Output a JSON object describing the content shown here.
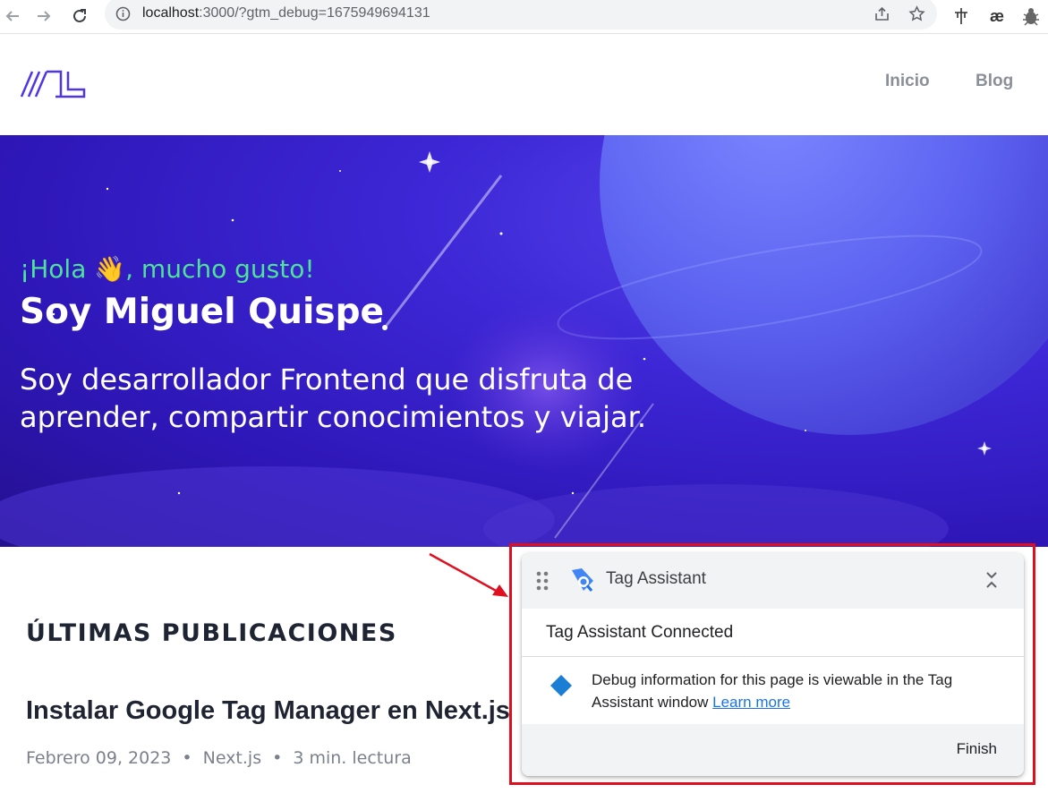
{
  "browser": {
    "url_host": "localhost",
    "url_rest": ":3000/?gtm_debug=1675949694131",
    "icons": [
      "back-icon",
      "forward-icon",
      "reload-icon",
      "info-icon",
      "share-icon",
      "star-icon",
      "move-icon",
      "ae-extension-icon",
      "bug-extension-icon"
    ],
    "ext_ae_label": "æ"
  },
  "header": {
    "nav": {
      "inicio": "Inicio",
      "blog": "Blog"
    },
    "logo_color": "#4f35e6"
  },
  "hero": {
    "greeting_pre": "¡Hola ",
    "greeting_emoji": "👋",
    "greeting_post": ", mucho gusto!",
    "name": "Soy Miguel Quispe",
    "description": "Soy desarrollador Frontend que disfruta de aprender, compartir conocimientos y viajar.",
    "accent_color": "#4ee29a"
  },
  "main": {
    "section_title": "ÚLTIMAS PUBLICACIONES",
    "post": {
      "title": "Instalar Google Tag Manager en Next.js",
      "date": "Febrero 09, 2023",
      "category": "Next.js",
      "reading_time": "3 min. lectura",
      "separator": "•"
    }
  },
  "tag_assistant": {
    "title": "Tag Assistant",
    "status": "Tag Assistant Connected",
    "message": "Debug information for this page is viewable in the Tag Assistant window",
    "link_text": "Learn more",
    "finish_label": "Finish",
    "link_color": "#1a73e8",
    "diamond_color": "#1a7fd4"
  },
  "annotation": {
    "color": "#e00f1f"
  }
}
